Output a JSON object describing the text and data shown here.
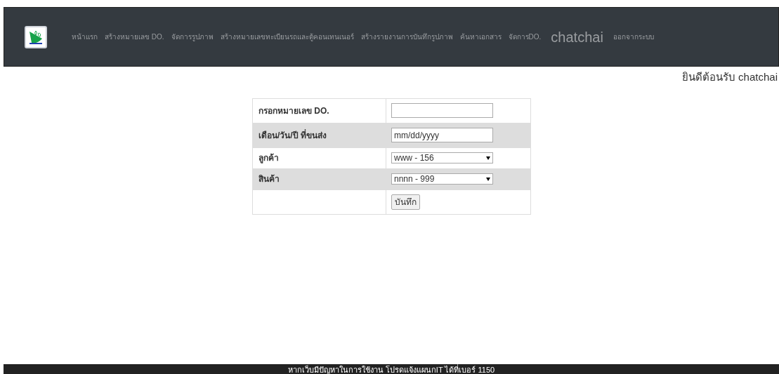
{
  "nav": {
    "items": [
      {
        "label": "หน้าแรก",
        "kind": "link"
      },
      {
        "label": "สร้างหมายเลข DO.",
        "kind": "link"
      },
      {
        "label": "จัดการรูปภาพ",
        "kind": "link"
      },
      {
        "label": "สร้างหมายเลขทะเบียนรถและตู้คอนเทนเนอร์",
        "kind": "link"
      },
      {
        "label": "สร้างรายงานการบันทึกรูปภาพ",
        "kind": "link"
      },
      {
        "label": "ค้นหาเอกสาร",
        "kind": "link"
      },
      {
        "label": "จัดการDO.",
        "kind": "link"
      },
      {
        "label": "chatchai",
        "kind": "user"
      },
      {
        "label": "ออกจากระบบ",
        "kind": "link"
      }
    ]
  },
  "welcome": "ยินดีต้อนรับ chatchai",
  "form": {
    "rows": [
      {
        "label": "กรอกหมายเลข DO.",
        "kind": "text",
        "value": ""
      },
      {
        "label": "เดือน/วัน/ปี ที่ขนส่ง",
        "kind": "date",
        "placeholder": "mm/dd/yyyy"
      },
      {
        "label": "ลูกค้า",
        "kind": "select",
        "value": "www - 156"
      },
      {
        "label": "สินค้า",
        "kind": "select",
        "value": "nnnn - 999"
      }
    ],
    "submit": "บันทึก"
  },
  "footer": "หากเว็บมีปัญหาในการใช้งาน โปรดแจ้งแผนกIT ได้ที่เบอร์ 1150"
}
